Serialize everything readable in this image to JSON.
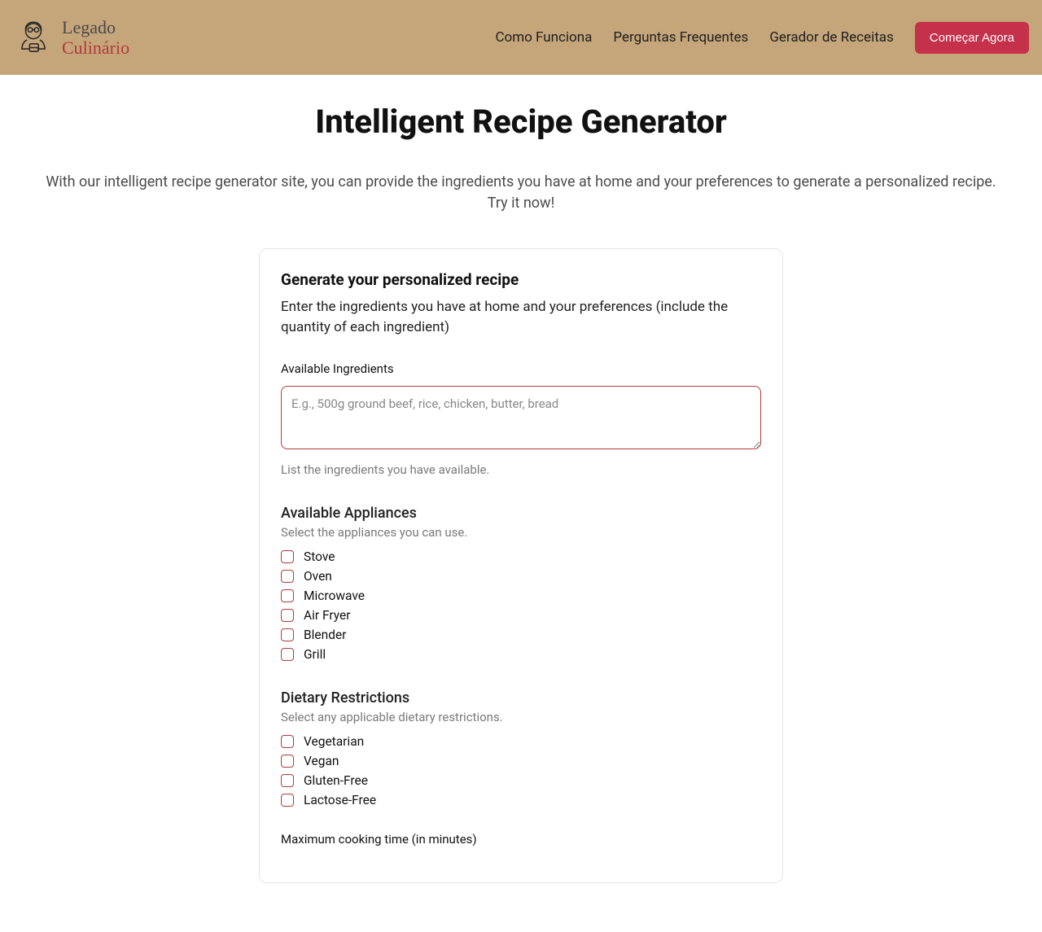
{
  "nav": {
    "brand_line1": "Legado",
    "brand_line2": "Culinário",
    "links": [
      "Como Funciona",
      "Perguntas Frequentes",
      "Gerador de Receitas"
    ],
    "cta": "Começar Agora"
  },
  "page": {
    "title": "Intelligent Recipe Generator",
    "description": "With our intelligent recipe generator site, you can provide the ingredients you have at home and your preferences to generate a personalized recipe. Try it now!"
  },
  "card": {
    "title": "Generate your personalized recipe",
    "subtitle": "Enter the ingredients you have at home and your preferences (include the quantity of each ingredient)",
    "ingredients": {
      "label": "Available Ingredients",
      "placeholder": "E.g., 500g ground beef, rice, chicken, butter, bread",
      "hint": "List the ingredients you have available."
    },
    "appliances": {
      "title": "Available Appliances",
      "subtitle": "Select the appliances you can use.",
      "options": [
        "Stove",
        "Oven",
        "Microwave",
        "Air Fryer",
        "Blender",
        "Grill"
      ]
    },
    "restrictions": {
      "title": "Dietary Restrictions",
      "subtitle": "Select any applicable dietary restrictions.",
      "options": [
        "Vegetarian",
        "Vegan",
        "Gluten-Free",
        "Lactose-Free"
      ]
    },
    "maxtime": {
      "label": "Maximum cooking time (in minutes)"
    }
  }
}
